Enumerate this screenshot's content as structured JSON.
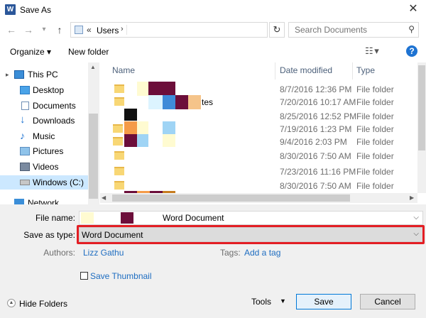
{
  "window": {
    "title": "Save As",
    "app_icon": "word-icon",
    "close": "✕"
  },
  "address": {
    "crumb_sep": "«",
    "crumb": "Users",
    "chevron": "›",
    "refresh": "↻"
  },
  "search": {
    "placeholder": "Search Documents"
  },
  "toolbar": {
    "organize": "Organize ▾",
    "new_folder": "New folder",
    "view": "☷ ▾",
    "help": "?"
  },
  "nav": {
    "items": [
      {
        "label": "This PC",
        "icon": "pc-icon"
      },
      {
        "label": "Desktop",
        "icon": "desktop-icon"
      },
      {
        "label": "Documents",
        "icon": "documents-icon"
      },
      {
        "label": "Downloads",
        "icon": "downloads-icon"
      },
      {
        "label": "Music",
        "icon": "music-icon"
      },
      {
        "label": "Pictures",
        "icon": "pictures-icon"
      },
      {
        "label": "Videos",
        "icon": "videos-icon"
      },
      {
        "label": "Windows (C:)",
        "icon": "drive-icon"
      },
      {
        "label": "Network",
        "icon": "network-icon"
      }
    ]
  },
  "list": {
    "columns": {
      "name": "Name",
      "date": "Date modified",
      "type": "Type"
    },
    "rows": [
      {
        "name_suffix": "",
        "date": "8/7/2016 12:36 PM",
        "type": "File folder"
      },
      {
        "name_suffix": "tes",
        "date": "7/20/2016 10:17 AM",
        "type": "File folder"
      },
      {
        "name_suffix": "",
        "date": "8/25/2016 12:52 PM",
        "type": "File folder"
      },
      {
        "name_suffix": "",
        "date": "7/19/2016 1:23 PM",
        "type": "File folder"
      },
      {
        "name_suffix": "",
        "date": "9/4/2016 2:03 PM",
        "type": "File folder"
      },
      {
        "name_suffix": "",
        "date": "8/30/2016 7:50 AM",
        "type": "File folder"
      },
      {
        "name_suffix": "",
        "date": "7/23/2016 11:16 PM",
        "type": "File folder"
      },
      {
        "name_suffix": "",
        "date": "8/30/2016 7:50 AM",
        "type": "File folder"
      }
    ]
  },
  "form": {
    "file_name_label": "File name:",
    "file_name_value": "Word Document",
    "save_type_label": "Save as type:",
    "save_type_value": "Word Document",
    "authors_label": "Authors:",
    "authors_value": "Lizz Gathu",
    "tags_label": "Tags:",
    "tags_value": "Add a tag",
    "thumbnail_label": "Save Thumbnail"
  },
  "footer": {
    "hide_folders": "Hide Folders",
    "tools": "Tools",
    "save": "Save",
    "cancel": "Cancel"
  },
  "colors": {
    "highlight": "#e31e24",
    "link": "#1e6dc1",
    "folder": "#f8d775"
  }
}
